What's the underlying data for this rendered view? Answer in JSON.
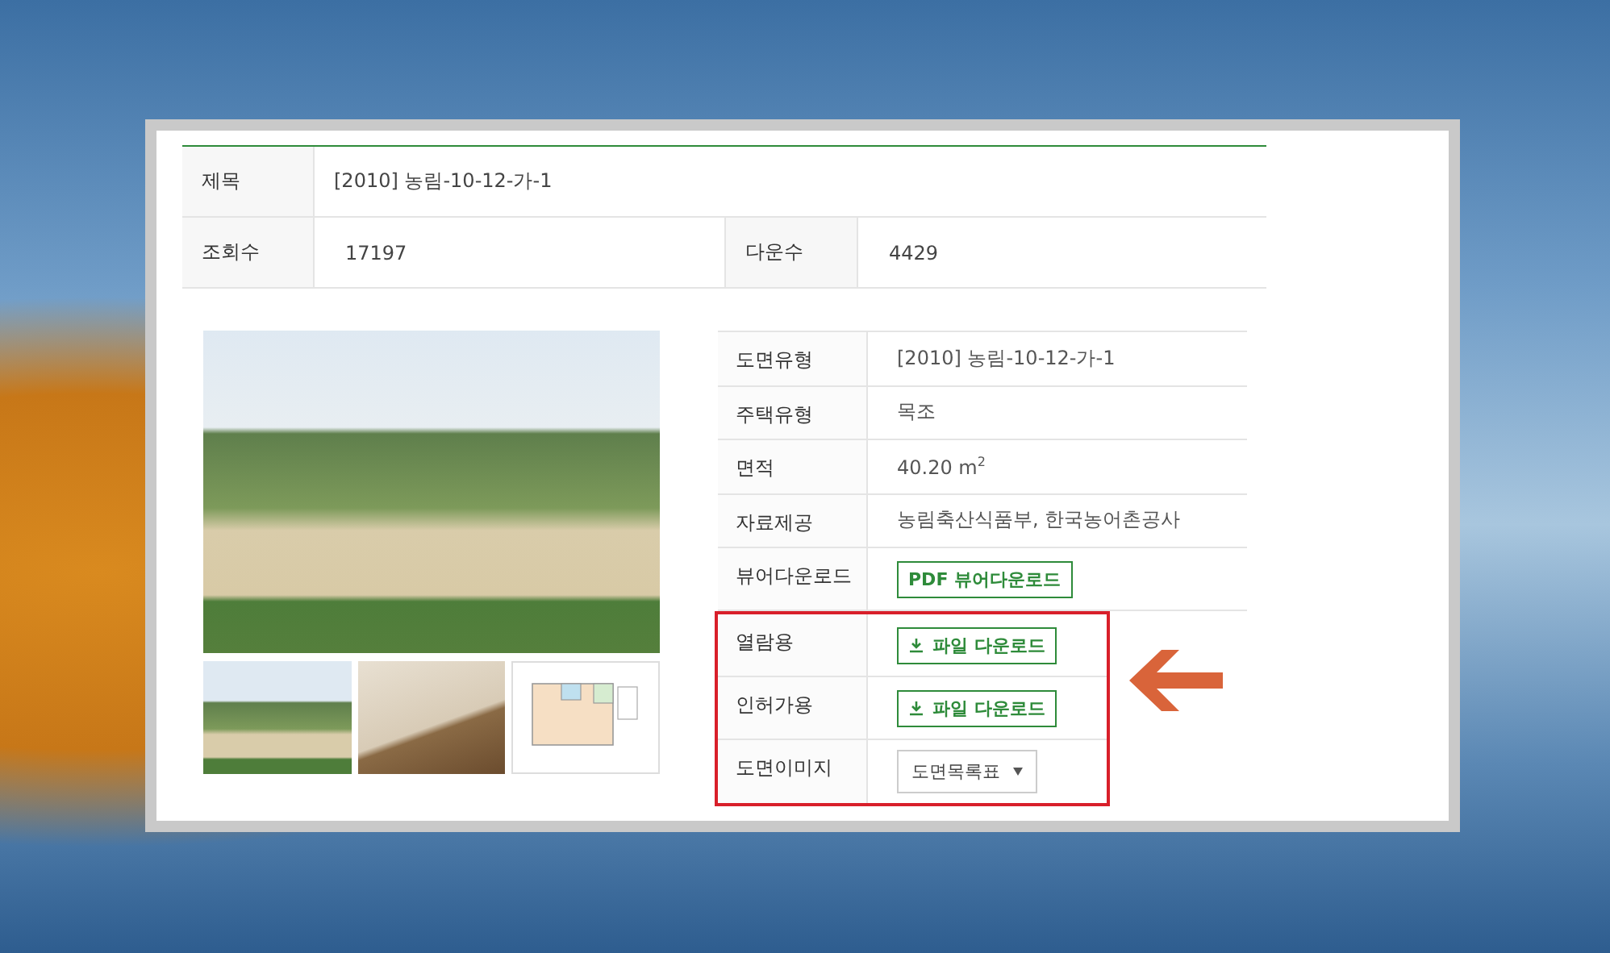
{
  "summary_table": {
    "title": {
      "label": "제목",
      "value": "[2010] 농림-10-12-가-1"
    },
    "stats": [
      {
        "label": "조회수",
        "value": "17197"
      },
      {
        "label": "다운수",
        "value": "4429"
      }
    ]
  },
  "details": [
    {
      "label": "도면유형",
      "kind": "text",
      "value": "[2010] 농림-10-12-가-1",
      "highlighted": false
    },
    {
      "label": "주택유형",
      "kind": "text",
      "value": "목조",
      "highlighted": false
    },
    {
      "label": "면적",
      "kind": "text",
      "value": "40.20 m$^{2}$",
      "highlighted": false
    },
    {
      "label": "자료제공",
      "kind": "text",
      "value": "농림축산식품부, 한국농어촌공사",
      "highlighted": false
    },
    {
      "label": "뷰어다운로드",
      "kind": "button",
      "value": "PDF 뷰어다운로드",
      "highlighted": false
    },
    {
      "label": "열람용",
      "kind": "download",
      "value": "파일 다운로드",
      "highlighted": true
    },
    {
      "label": "인허가용",
      "kind": "download",
      "value": "파일 다운로드",
      "highlighted": true
    },
    {
      "label": "도면이미지",
      "kind": "select",
      "value": "도면목록표",
      "highlighted": true
    }
  ]
}
